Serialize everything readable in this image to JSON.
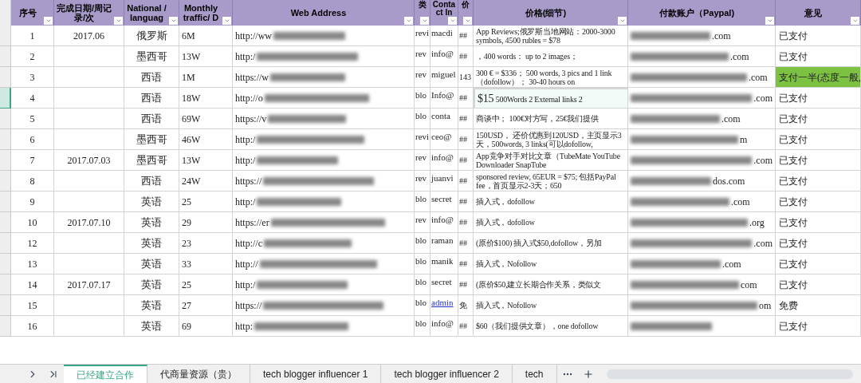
{
  "columns": [
    "序号",
    "完成日期/周记录/次",
    "National / languag",
    "Monthly traffic/ D",
    "Web Address",
    "类",
    "Conta ct In",
    "价",
    "价格(细节)",
    "付款账户（Paypal)",
    "意见"
  ],
  "rows": [
    {
      "index": "1",
      "date": "2017.06",
      "language": "俄罗斯",
      "traffic": "6M",
      "url": "http://ww",
      "type": "revi",
      "contact": "macdi",
      "contact_link": false,
      "price": "##",
      "price_detail": "App Reviews;俄罗斯当地网站：2000-3000 symbols, 4500 rubles = $78",
      "selected": false,
      "paypal": ".com",
      "note": "已支付",
      "highlighted": false
    },
    {
      "index": "2",
      "date": "",
      "language": "墨西哥",
      "traffic": "13W",
      "url": "http:/",
      "type": "rev",
      "contact": "info@",
      "contact_link": false,
      "price": "##",
      "price_detail": "，400 words： up to 2 images；",
      "selected": false,
      "paypal": ".com",
      "note": "已支付",
      "highlighted": false
    },
    {
      "index": "3",
      "date": "",
      "language": "西语",
      "traffic": "1M",
      "url": "https://w",
      "type": "rev",
      "contact": "miguel",
      "contact_link": false,
      "price": "143",
      "price_detail": "300 € = $336； 500 words, 3 pics and 1 link（dofollow）； 30-40 hours on",
      "selected": false,
      "paypal": ".com",
      "note": "支付一半(态度一般,",
      "highlighted": true
    },
    {
      "index": "4",
      "date": "",
      "language": "西语",
      "traffic": "18W",
      "url": "http://o",
      "type": "blo",
      "contact": "Info@",
      "contact_link": false,
      "price": "##",
      "price_detail": "**$15** 500Words 2 External links 2",
      "selected": true,
      "paypal": ".com",
      "note": "已支付",
      "highlighted": false
    },
    {
      "index": "5",
      "date": "",
      "language": "西语",
      "traffic": "69W",
      "url": "https://v",
      "type": "blo",
      "contact": "conta",
      "contact_link": false,
      "price": "##",
      "price_detail": "商谈中； 100€对方写，25€我们提供",
      "selected": false,
      "paypal": ".com",
      "note": "已支付",
      "highlighted": false
    },
    {
      "index": "6",
      "date": "",
      "language": "墨西哥",
      "traffic": "46W",
      "url": "http:/",
      "type": "revi",
      "contact": "ceo@",
      "contact_link": false,
      "price": "##",
      "price_detail": "150USD， 还价优惠到120USD，主页显示3天，500words, 3 links(可以dofollow,",
      "selected": false,
      "paypal": "m",
      "note": "已支付",
      "highlighted": false
    },
    {
      "index": "7",
      "date": "2017.07.03",
      "language": "墨西哥",
      "traffic": "13W",
      "url": "http:/",
      "type": "rev",
      "contact": "info@",
      "contact_link": false,
      "price": "##",
      "price_detail": "App竞争对手对比文章（TubeMate YouTube Downloader SnapTube",
      "selected": false,
      "paypal": ".com",
      "note": "已支付",
      "highlighted": false
    },
    {
      "index": "8",
      "date": "",
      "language": "西语",
      "traffic": "24W",
      "url": "https://",
      "type": "rev",
      "contact": "juanvi",
      "contact_link": false,
      "price": "##",
      "price_detail": "sponsored review, 65EUR = $75; 包括PayPal fee，首页显示2-3天；650",
      "selected": false,
      "paypal": "dos.com",
      "note": "已支付",
      "highlighted": false
    },
    {
      "index": "9",
      "date": "",
      "language": "英语",
      "traffic": "25",
      "url": "http:/",
      "type": "blo",
      "contact": "secret",
      "contact_link": false,
      "price": "##",
      "price_detail": "插入式，dofollow",
      "selected": false,
      "paypal": ".com",
      "note": "已支付",
      "highlighted": false
    },
    {
      "index": "10",
      "date": "2017.07.10",
      "language": "英语",
      "traffic": "29",
      "url": "https://er",
      "type": "rev",
      "contact": "info@",
      "contact_link": false,
      "price": "##",
      "price_detail": "插入式，dofollow",
      "selected": false,
      "paypal": ".org",
      "note": "已支付",
      "highlighted": false
    },
    {
      "index": "12",
      "date": "",
      "language": "英语",
      "traffic": "23",
      "url": "http://c",
      "type": "blo",
      "contact": "raman",
      "contact_link": false,
      "price": "##",
      "price_detail": "(原价$100) 插入式$50,dofollow，另加",
      "selected": false,
      "paypal": ".com",
      "note": "已支付",
      "highlighted": false
    },
    {
      "index": "13",
      "date": "",
      "language": "英语",
      "traffic": "33",
      "url": "http://",
      "type": "blo",
      "contact": "manik",
      "contact_link": false,
      "price": "##",
      "price_detail": "插入式，Nofollow",
      "selected": false,
      "paypal": ".com",
      "note": "已支付",
      "highlighted": false
    },
    {
      "index": "14",
      "date": "2017.07.17",
      "language": "英语",
      "traffic": "25",
      "url": "http:/",
      "type": "blo",
      "contact": "secret",
      "contact_link": false,
      "price": "##",
      "price_detail": "(原价$50,建立长期合作关系，类似文",
      "selected": false,
      "paypal": "com",
      "note": "已支付",
      "highlighted": false
    },
    {
      "index": "15",
      "date": "",
      "language": "英语",
      "traffic": "27",
      "url": "https://",
      "type": "blo",
      "contact": "admin",
      "contact_link": true,
      "price": "免",
      "price_detail": "插入式，Nofollow",
      "selected": false,
      "paypal": "om",
      "note": "免费",
      "highlighted": false
    },
    {
      "index": "16",
      "date": "",
      "language": "英语",
      "traffic": "69",
      "url": "http:",
      "type": "blo",
      "contact": "info@",
      "contact_link": false,
      "price": "##",
      "price_detail": "$60（我们提供文章），one dofollow",
      "selected": false,
      "paypal": "",
      "note": "已支付",
      "highlighted": false
    }
  ],
  "sheet_tabs": [
    {
      "label": "已经建立合作",
      "selected": true
    },
    {
      "label": "代商量资源（贵）",
      "selected": false
    },
    {
      "label": "tech blogger influencer 1",
      "selected": false
    },
    {
      "label": "tech blogger influencer 2",
      "selected": false
    },
    {
      "label": "tech",
      "selected": false
    }
  ]
}
